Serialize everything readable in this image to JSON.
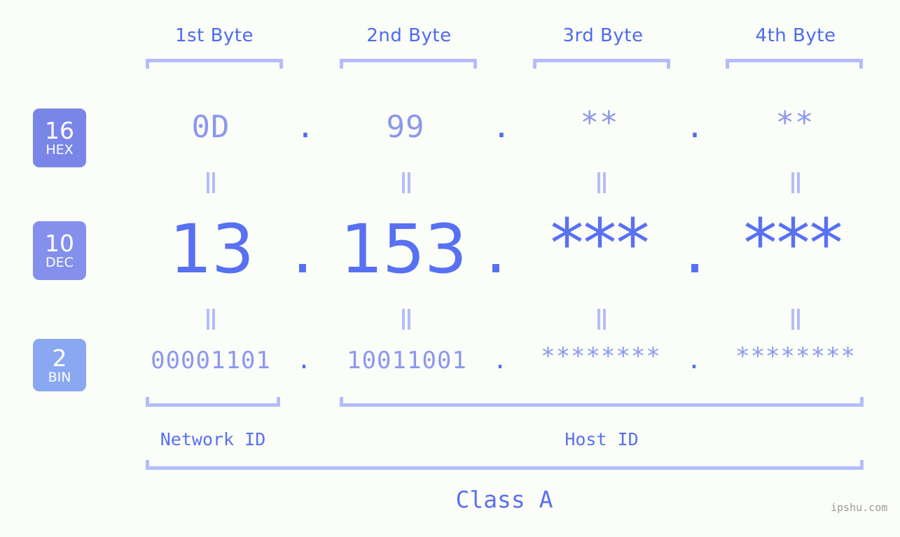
{
  "meta": {
    "watermark": "ipshu.com",
    "accent_color": "#5771f2",
    "muted_color": "#8b98ee",
    "bracket_color": "#b4bdfb",
    "background_color": "#fbfdf8"
  },
  "byte_headers": [
    {
      "label": "1st Byte"
    },
    {
      "label": "2nd Byte"
    },
    {
      "label": "3rd Byte"
    },
    {
      "label": "4th Byte"
    }
  ],
  "bases": [
    {
      "number": "16",
      "name": "HEX"
    },
    {
      "number": "10",
      "name": "DEC"
    },
    {
      "number": "2",
      "name": "BIN"
    }
  ],
  "rows": {
    "hex": {
      "values": [
        "0D",
        "99",
        "**",
        "**"
      ],
      "separator": "."
    },
    "dec": {
      "values": [
        "13",
        "153",
        "***",
        "***"
      ],
      "separator": "."
    },
    "bin": {
      "values": [
        "00001101",
        "10011001",
        "********",
        "********"
      ],
      "separator": "."
    }
  },
  "equality_symbol": "||",
  "segments": {
    "network_id": "Network ID",
    "host_id": "Host ID",
    "class": "Class A"
  }
}
